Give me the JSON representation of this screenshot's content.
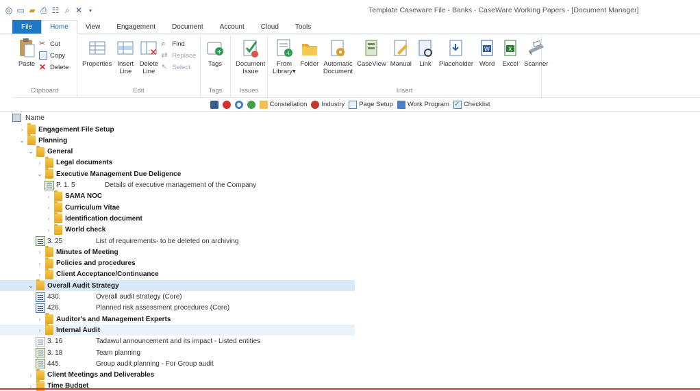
{
  "window": {
    "title": "Template Caseware File - Banks - CaseWare Working Papers - [Document Manager]"
  },
  "quick_access": [
    "app-icon",
    "save-icon",
    "open-icon",
    "print-icon",
    "properties-icon",
    "preview-icon",
    "close-x-icon",
    "dropdown-icon"
  ],
  "tabs": [
    {
      "label": "File"
    },
    {
      "label": "Home"
    },
    {
      "label": "View"
    },
    {
      "label": "Engagement"
    },
    {
      "label": "Document"
    },
    {
      "label": "Account"
    },
    {
      "label": "Cloud"
    },
    {
      "label": "Tools"
    }
  ],
  "ribbon": {
    "clipboard": {
      "label": "Clipboard",
      "paste": "Paste",
      "cut": "Cut",
      "copy": "Copy",
      "delete": "Delete"
    },
    "edit": {
      "label": "Edit",
      "properties": "Properties",
      "insert_line": "Insert\nLine",
      "delete_line": "Delete\nLine",
      "find": "Find",
      "replace": "Replace",
      "select": "Select"
    },
    "tags": {
      "label": "Tags",
      "tags": "Tags"
    },
    "issues": {
      "label": "Issues",
      "document_issue": "Document\nIssue"
    },
    "insert": {
      "label": "Insert",
      "from_library": "From\nLibrary▾",
      "folder": "Folder",
      "automatic_document": "Automatic\nDocument",
      "caseview": "CaseView",
      "manual": "Manual",
      "link": "Link",
      "placeholder": "Placeholder",
      "word": "Word",
      "excel": "Excel",
      "scanner": "Scanner"
    }
  },
  "strip": {
    "constellation": "Constellation",
    "industry": "Industry",
    "page_setup": "Page Setup",
    "work_program": "Work Program",
    "checklist": "Checklist"
  },
  "tree": {
    "header": "Name",
    "rows": [
      {
        "type": "folder",
        "indent": 0,
        "open": false,
        "label": "Engagement File Setup"
      },
      {
        "type": "folder",
        "indent": 0,
        "open": true,
        "label": "Planning"
      },
      {
        "type": "folder",
        "indent": 1,
        "open": true,
        "label": "General"
      },
      {
        "type": "folder",
        "indent": 2,
        "open": false,
        "label": "Legal documents"
      },
      {
        "type": "folder",
        "indent": 2,
        "open": true,
        "label": "Executive Management Due Deligence"
      },
      {
        "type": "doc",
        "indent": 3,
        "num": "P. 1. 5",
        "title": "Details of executive management of the Company",
        "icon": "green"
      },
      {
        "type": "folder",
        "indent": 3,
        "open": false,
        "label": "SAMA NOC"
      },
      {
        "type": "folder",
        "indent": 3,
        "open": false,
        "label": "Curriculum Vitae"
      },
      {
        "type": "folder",
        "indent": 3,
        "open": false,
        "label": "Identification document"
      },
      {
        "type": "folder",
        "indent": 3,
        "open": false,
        "label": "World check"
      },
      {
        "type": "doc",
        "indent": 2,
        "num": "3. 25",
        "title": "List of requirements- to be deleted on archiving",
        "icon": "green"
      },
      {
        "type": "folder",
        "indent": 2,
        "open": false,
        "label": "Minutes of Meeting"
      },
      {
        "type": "folder",
        "indent": 2,
        "open": false,
        "label": "Policies and procedures"
      },
      {
        "type": "folder",
        "indent": 2,
        "open": false,
        "label": "Client Acceptance/Continuance"
      },
      {
        "type": "folder",
        "indent": 1,
        "open": true,
        "label": "Overall Audit Strategy",
        "state": "selected"
      },
      {
        "type": "doc",
        "indent": 2,
        "num": "430.",
        "title": "Overall audit strategy (Core)",
        "icon": "blue"
      },
      {
        "type": "doc",
        "indent": 2,
        "num": "426.",
        "title": "Planned risk assessment procedures (Core)",
        "icon": "blue"
      },
      {
        "type": "folder",
        "indent": 2,
        "open": false,
        "label": "Auditor's and Management Experts"
      },
      {
        "type": "folder",
        "indent": 2,
        "open": false,
        "label": "Internal Audit",
        "state": "hover"
      },
      {
        "type": "doc",
        "indent": 2,
        "num": "3. 16",
        "title": "Tadawul announcement and its impact - Listed entities",
        "icon": "plain"
      },
      {
        "type": "doc",
        "indent": 2,
        "num": "3. 18",
        "title": "Team planning",
        "icon": "green"
      },
      {
        "type": "doc",
        "indent": 2,
        "num": "445.",
        "title": "Group audit planning - For Group audit",
        "icon": "green"
      },
      {
        "type": "folder",
        "indent": 1,
        "open": false,
        "label": "Client Meetings and Deliverables"
      },
      {
        "type": "folder",
        "indent": 1,
        "open": false,
        "label": "Time Budget"
      }
    ]
  }
}
